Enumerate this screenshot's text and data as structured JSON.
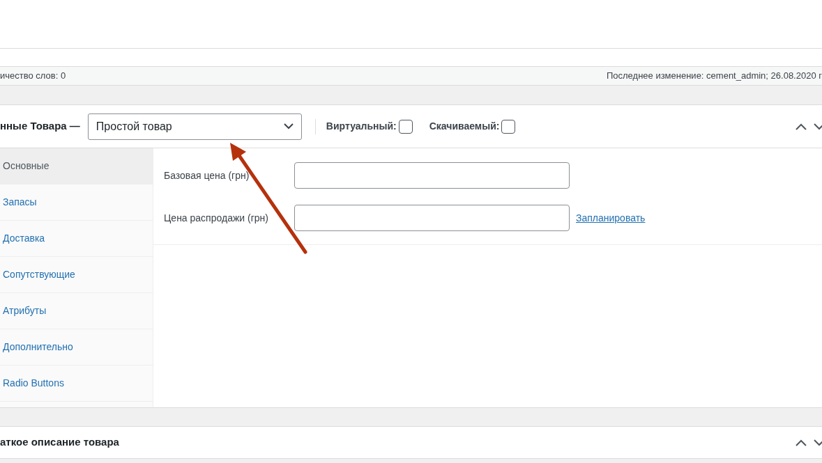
{
  "status_bar": {
    "word_count": "ичество слов: 0",
    "last_edit": "Последнее изменение: cement_admin; 26.08.2020 г"
  },
  "product_data": {
    "title": "нные Товара —",
    "product_type": "Простой товар",
    "virtual": {
      "label": "Виртуальный:",
      "checked": false
    },
    "downloadable": {
      "label": "Скачиваемый:",
      "checked": false
    },
    "tabs": [
      {
        "label": "Основные",
        "selected": true
      },
      {
        "label": "Запасы",
        "selected": false
      },
      {
        "label": "Доставка",
        "selected": false
      },
      {
        "label": "Сопутствующие",
        "selected": false
      },
      {
        "label": "Атрибуты",
        "selected": false
      },
      {
        "label": "Дополнительно",
        "selected": false
      },
      {
        "label": "Radio Buttons",
        "selected": false
      }
    ],
    "fields": [
      {
        "label": "Базовая цена (грн)"
      },
      {
        "label": "Цена распродажи (грн)",
        "link": "Запланировать"
      }
    ]
  },
  "short_description": {
    "title": "аткое описание товара"
  }
}
